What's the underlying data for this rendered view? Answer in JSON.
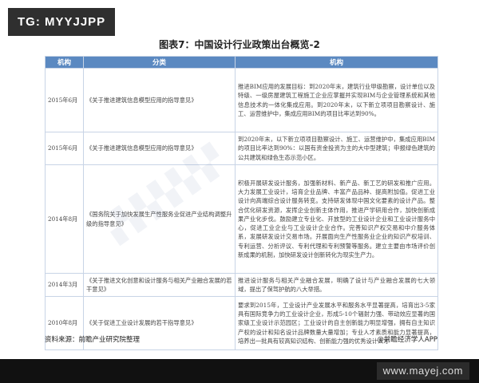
{
  "tag": "TG: MYYJJPP",
  "title": "图表7：中国设计行业政策出台概览-2",
  "table": {
    "headers": [
      "机构",
      "分类",
      "机构"
    ],
    "rows": [
      {
        "date": "2015年6月",
        "category": "《关于推进建筑信息模型应用的指导意见》",
        "desc": "推进BIM应用的发展目标：到2020年末，建筑行业甲级勘察，设计单位以及特级、一级房屋建筑工程施工企业应掌握并实现BIM与企业管理系统和其他信息技术的一体化集成应用。到2020年末，以下新立项项目勘察设计、施工、运营维护中，集成应用BIM的项目比率达到90%。"
      },
      {
        "date": "2015年6月",
        "category": "《关于推进建筑信息模型应用的指导意见》",
        "desc": "到2020年末，以下新立项项目勘察设计、施工、运营维护中，集成应用BIM的项目比率达到90%：以国有资金投资为主的大中型建筑；申报绿色建筑的公共建筑和绿色生态示范小区。"
      },
      {
        "date": "2014年8月",
        "category": "《国务院关于加快发展生产性服务业促进产业结构调整升级的指导意见》",
        "desc": "积极开展研发设计服务，加强新材料、新产品、新工艺的研发和推广应用。大力发展工业设计，培育企业品牌、丰富产品品种、提高附加值。促进工业设计向高端综合设计服务转变。支持研发体现中国文化要素的设计产品。整合优化研发资源，发挥企业创新主体作用，推进产学研用合作，加快创新成果产业化步伐。鼓励建立专业化、开放型的工业设计企业和工业设计服务中心，促进工业企业与工业设计企业合作。完善知识产权交易和中介服务体系，发展研发设计交易市场。开展面向生产性服务业企业的知识产权培训、专利运营、分析评议、专利代理和专利预警等服务。建立主要由市场评价创新成果的机制，加快研发设计创新转化为现实生产力。"
      },
      {
        "date": "2014年3月",
        "category": "《关于推进文化创意和设计服务与相关产业融合发展的若干意见》",
        "desc": "推进设计服务与相关产业融合发展，明确了设计与产业融合发展的七大领域，提出了保驾护航的八大举措。"
      },
      {
        "date": "2010年8月",
        "category": "《关于促进工业设计发展的若干指导意见》",
        "desc": "要求到2015年，工业设计产业发展水平和服务水平显著提高，培育出3-5家具有国际竞争力的工业设计企业，形成5-10个辐射力强、带动效应显著的国家级工业设计示范园区；工业设计的自主创新能力明显增强，拥有自主知识产权的设计和知名设计品牌数量大量增加；专业人才素质和能力显著提高，培养出一批具有较高知识结构、创新能力强的优秀设计人才"
      }
    ]
  },
  "footer": {
    "source": "资料来源：前瞻产业研究院整理",
    "credit": "@前瞻经济学人APP"
  },
  "site_link": "www.mayej.com"
}
